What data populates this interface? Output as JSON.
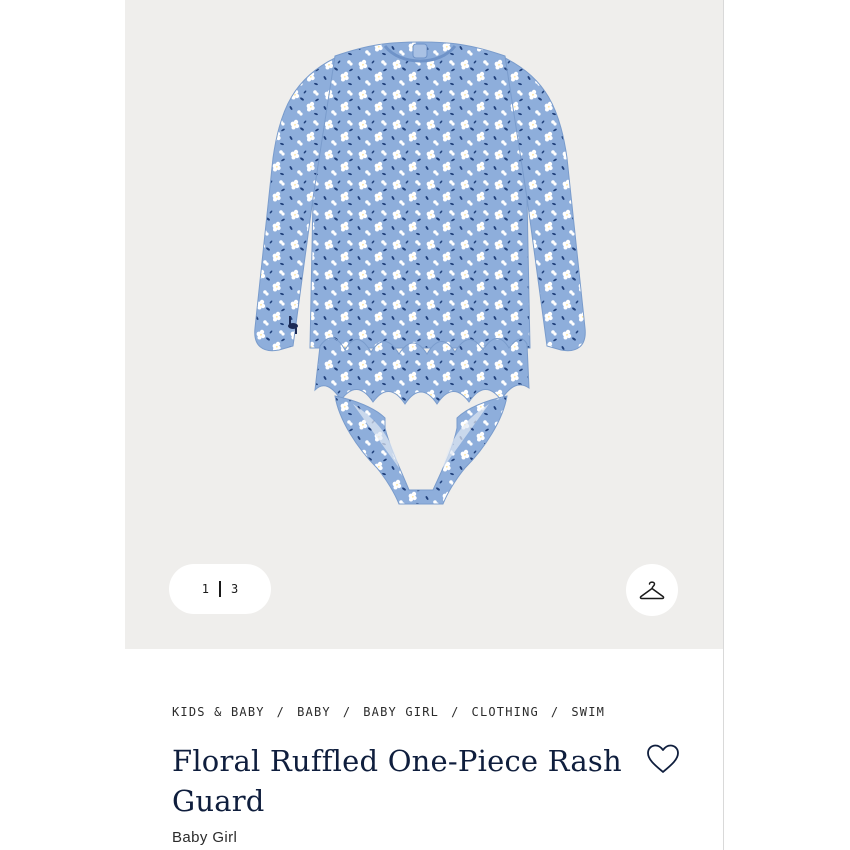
{
  "gallery": {
    "image_alt": "Floral ruffled one-piece rash guard, light blue with white floral print",
    "current_index": "1",
    "total": "3",
    "hanger_icon": "hanger-icon"
  },
  "breadcrumb": [
    "KIDS & BABY",
    "BABY",
    "BABY GIRL",
    "CLOTHING",
    "SWIM"
  ],
  "product": {
    "title": "Floral Ruffled One-Piece Rash Guard",
    "subtitle": "Baby Girl",
    "favorite_icon": "heart-icon"
  },
  "colors": {
    "gallery_bg": "#efeeec",
    "fabric": "#8eaedb",
    "title": "#0f1e3d"
  }
}
